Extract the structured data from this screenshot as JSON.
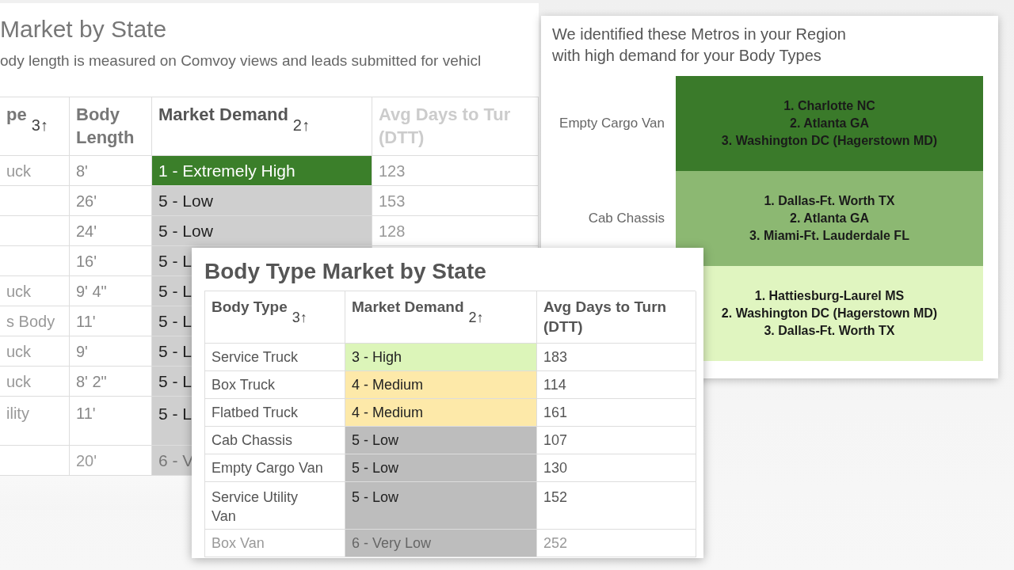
{
  "back_panel": {
    "title": "Market by State",
    "subtitle": "ody length is measured on Comvoy views and leads submitted for vehicl",
    "columns": [
      {
        "label": "pe",
        "sort": "3↑"
      },
      {
        "label": "Body Length"
      },
      {
        "label": "Market Demand",
        "sort": "2↑"
      },
      {
        "label": "Avg Days to Tur\n(DTT)"
      }
    ],
    "rows": [
      {
        "body_type": "uck",
        "length": "8'",
        "demand": {
          "text": "1 - Extremely High",
          "color": "#3b7f2a"
        },
        "dtt": "123",
        "faded": false
      },
      {
        "length": "26'",
        "demand": {
          "text": "5 - Low",
          "color": "#cfcfcf"
        },
        "dtt": "153",
        "faded": false
      },
      {
        "length": "24'",
        "demand": {
          "text": "5 - Low",
          "color": "#cfcfcf"
        },
        "dtt": "128",
        "faded": false
      },
      {
        "length": "16'",
        "demand": {
          "text": "5 - L",
          "color": "#cfcfcf"
        },
        "faded": false
      },
      {
        "body_type": "uck",
        "length": "9' 4\"",
        "demand": {
          "text": "5 - L",
          "color": "#cfcfcf"
        },
        "faded": false
      },
      {
        "body_type": "s Body",
        "length": "11'",
        "demand": {
          "text": "5 - L",
          "color": "#cfcfcf"
        },
        "faded": false
      },
      {
        "body_type": "uck",
        "length": "9'",
        "demand": {
          "text": "5 - L",
          "color": "#cfcfcf"
        },
        "faded": false
      },
      {
        "body_type": "uck",
        "length": "8' 2\"",
        "demand": {
          "text": "5 - L",
          "color": "#cfcfcf"
        },
        "faded": false
      },
      {
        "body_type": "ility",
        "length": "11'",
        "demand": {
          "text": "5 - L",
          "color": "#cfcfcf"
        },
        "faded": false,
        "tall": true
      },
      {
        "length": "20'",
        "demand": {
          "text": "6 - V",
          "color": "#cfcfcf"
        },
        "faded": true
      }
    ]
  },
  "metros_panel": {
    "title": "We identified these Metros in your Region\nwith high demand for your Body Types",
    "rows": [
      {
        "label": "Empty Cargo Van",
        "color": "#3a7a2a",
        "metros": [
          "1. Charlotte NC",
          "2. Atlanta GA",
          "3. Washington DC (Hagerstown MD)"
        ]
      },
      {
        "label": "Cab Chassis",
        "color": "#8cb872",
        "metros": [
          "1. Dallas-Ft. Worth TX",
          "2. Atlanta GA",
          "3. Miami-Ft. Lauderdale FL"
        ]
      },
      {
        "color": "#e0f5c0",
        "metros": [
          "1. Hattiesburg-Laurel MS",
          "2. Washington DC (Hagerstown MD)",
          "3. Dallas-Ft. Worth TX"
        ]
      }
    ]
  },
  "front_panel": {
    "title": "Body Type Market by State",
    "columns": [
      {
        "label": "Body Type",
        "sort": "3↑"
      },
      {
        "label": "Market Demand",
        "sort": "2↑"
      },
      {
        "label": "Avg Days to Turn\n(DTT)"
      }
    ],
    "rows": [
      {
        "body_type": "Service Truck",
        "demand": {
          "text": "3 - High",
          "color": "#dcf5b9"
        },
        "dtt": "183",
        "faded": false
      },
      {
        "body_type": "Box Truck",
        "demand": {
          "text": "4 - Medium",
          "color": "#fde9a9"
        },
        "dtt": "114",
        "faded": false
      },
      {
        "body_type": "Flatbed Truck",
        "demand": {
          "text": "4 - Medium",
          "color": "#fde9a9"
        },
        "dtt": "161",
        "faded": false
      },
      {
        "body_type": "Cab Chassis",
        "demand": {
          "text": "5 - Low",
          "color": "#bdbdbd"
        },
        "dtt": "107",
        "faded": false
      },
      {
        "body_type": "Empty Cargo Van",
        "demand": {
          "text": "5 - Low",
          "color": "#bdbdbd"
        },
        "dtt": "130",
        "faded": false
      },
      {
        "body_type": "Service Utility\nVan",
        "demand": {
          "text": "5 - Low",
          "color": "#bdbdbd"
        },
        "dtt": "152",
        "faded": false,
        "tall": true
      },
      {
        "body_type": "Box Van",
        "demand": {
          "text": "6 - Very Low",
          "color": "#bdbdbd"
        },
        "dtt": "252",
        "faded": true
      }
    ]
  }
}
